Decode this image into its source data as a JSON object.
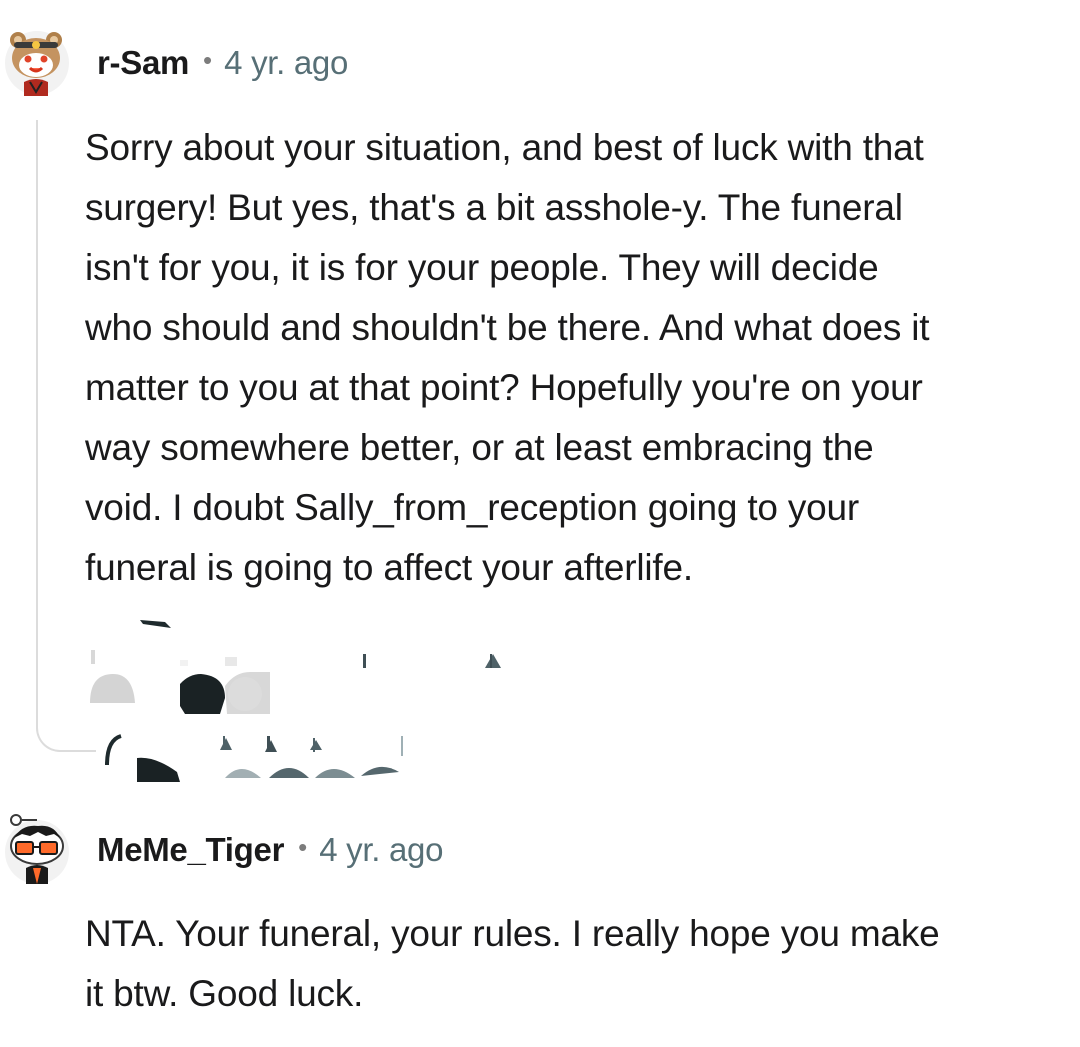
{
  "comments": [
    {
      "username": "r-Sam",
      "separator": "•",
      "age": "4 yr. ago",
      "avatar": "bear-snoo-avatar",
      "body_lines": [
        "Sorry about your situation, and best of luck with that",
        "surgery! But yes, that's a bit asshole-y. The funeral",
        "isn't for you, it is for your people. They will decide",
        "who should and shouldn't be there. And what does it",
        "matter to you at that point? Hopefully you're on your",
        "way somewhere better, or at least embracing the",
        "void. I doubt Sally_from_reception going to your",
        "funeral is going to affect your afterlife."
      ]
    },
    {
      "username": "MeMe_Tiger",
      "separator": "•",
      "age": "4 yr. ago",
      "avatar": "glasses-snoo-avatar",
      "body_lines": [
        "NTA. Your funeral, your rules. I really hope you make",
        "it btw. Good luck."
      ]
    }
  ],
  "icons": {
    "thread": "thread-connector-line",
    "actions": "obscured-action-icons"
  },
  "colors": {
    "text": "#1a1a1b",
    "meta": "#576f76",
    "thread": "#dcdcdc",
    "background": "#ffffff"
  }
}
